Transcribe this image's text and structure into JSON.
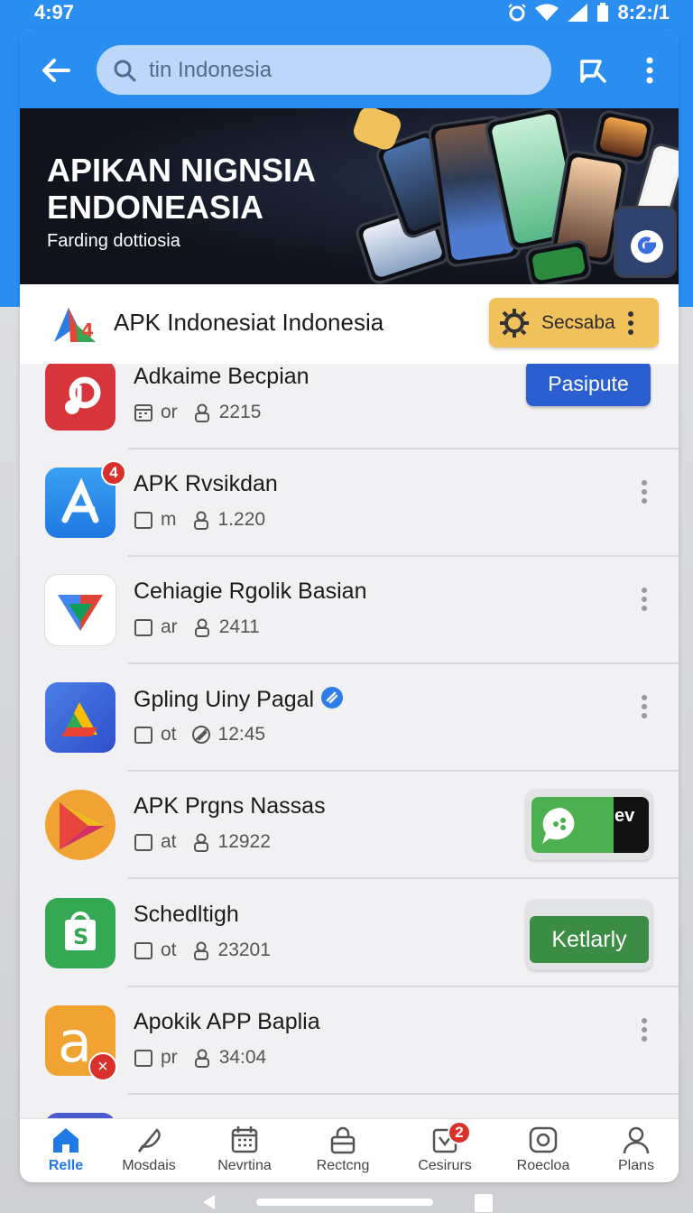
{
  "status_bar": {
    "left_time": "4:97",
    "right_time": "8:2:/1"
  },
  "search": {
    "value": "tin Indonesia"
  },
  "banner": {
    "title_line1": "APIKAN NIGNSIA",
    "title_line2": "ENDONEASIA",
    "subtitle": "Farding dottiosia"
  },
  "header": {
    "brand_name": "APK Indonesiat Indonesia",
    "action_label": "Secsaba"
  },
  "apps": [
    {
      "name": "Adkaime Becpian",
      "meta_a": "or",
      "meta_b": "2215",
      "action": "Pasipute"
    },
    {
      "name": "APK Rvsikdan",
      "meta_a": "m",
      "meta_b": "1.220",
      "badge": "4"
    },
    {
      "name": "Cehiagie Rgolik Basian",
      "meta_a": "ar",
      "meta_b": "2411"
    },
    {
      "name": "Gpling Uiny Pagal",
      "meta_a": "ot",
      "meta_b": "12:45"
    },
    {
      "name": "APK Prgns Nassas",
      "meta_a": "at",
      "meta_b": "12922",
      "thumb_text": "ev"
    },
    {
      "name": "Schedltigh",
      "meta_a": "ot",
      "meta_b": "23201",
      "action": "Ketlarly"
    },
    {
      "name": "Apokik APP Baplia",
      "meta_a": "pr",
      "meta_b": "34:04"
    }
  ],
  "bottom_nav": [
    {
      "label": "Relle",
      "active": true
    },
    {
      "label": "Mosdais"
    },
    {
      "label": "Nevrtina"
    },
    {
      "label": "Rectcng"
    },
    {
      "label": "Cesirurs",
      "badge": "2"
    },
    {
      "label": "Roecloa"
    },
    {
      "label": "Plans"
    }
  ],
  "colors": {
    "primary": "#2a8ef0",
    "accent_yellow": "#f1c15b",
    "button_blue": "#2b5fd0",
    "button_green": "#3b8c45"
  }
}
